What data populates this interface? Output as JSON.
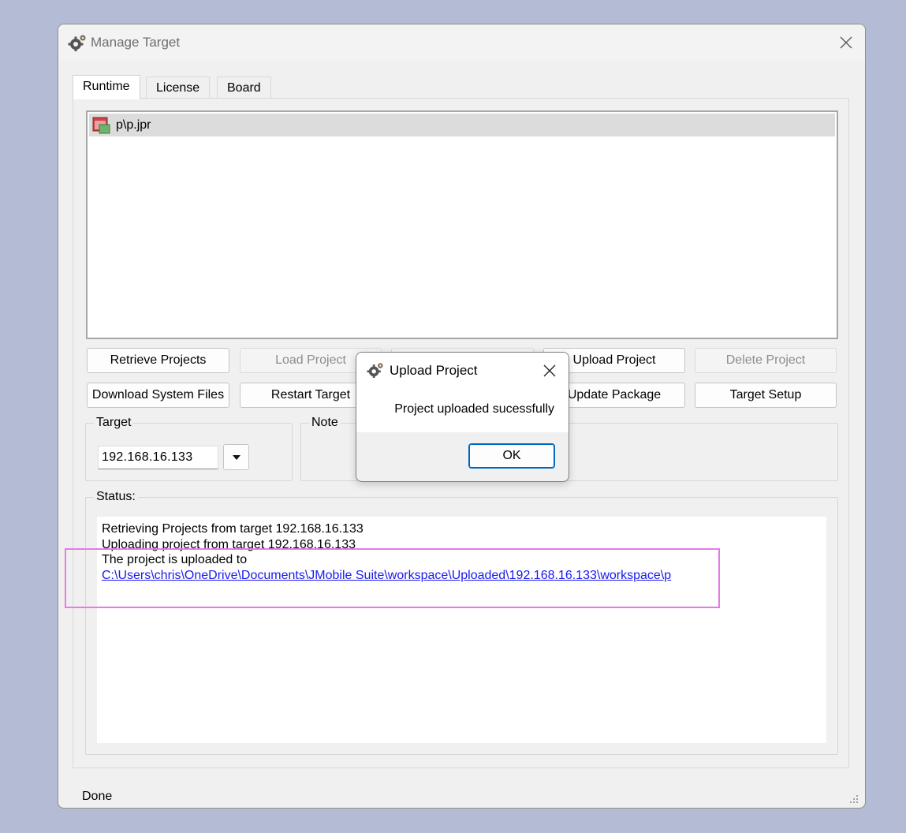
{
  "window": {
    "title": "Manage Target",
    "icon": "gear-icon"
  },
  "tabs": [
    {
      "label": "Runtime",
      "active": true
    },
    {
      "label": "License",
      "active": false
    },
    {
      "label": "Board",
      "active": false
    }
  ],
  "project_list": {
    "items": [
      {
        "label": "p\\p.jpr",
        "icon": "project-file-icon",
        "selected": true
      }
    ]
  },
  "buttons": {
    "retrieve_projects": "Retrieve Projects",
    "load_project": "Load Project",
    "upload_project": "Upload Project",
    "delete_project": "Delete Project",
    "download_system_files": "Download System Files",
    "restart_target": "Restart Target",
    "update_package": "Update Package",
    "target_setup": "Target Setup"
  },
  "target": {
    "label": "Target",
    "value": "192.168.16.133"
  },
  "note": {
    "label": "Note"
  },
  "status": {
    "label": "Status:",
    "lines": [
      "Retrieving Projects from target 192.168.16.133",
      "Uploading  project from target 192.168.16.133",
      "The project is uploaded to"
    ],
    "link": "C:\\Users\\chris\\OneDrive\\Documents\\JMobile Suite\\workspace\\Uploaded\\192.168.16.133\\workspace\\p"
  },
  "footer": {
    "status_text": "Done"
  },
  "dialog": {
    "title": "Upload Project",
    "message": "Project uploaded sucessfully",
    "ok_label": "OK"
  },
  "colors": {
    "desktop": "#b3bbd5",
    "link": "#1a1aee",
    "highlight": "#e77ae7",
    "accent": "#0067c0"
  }
}
